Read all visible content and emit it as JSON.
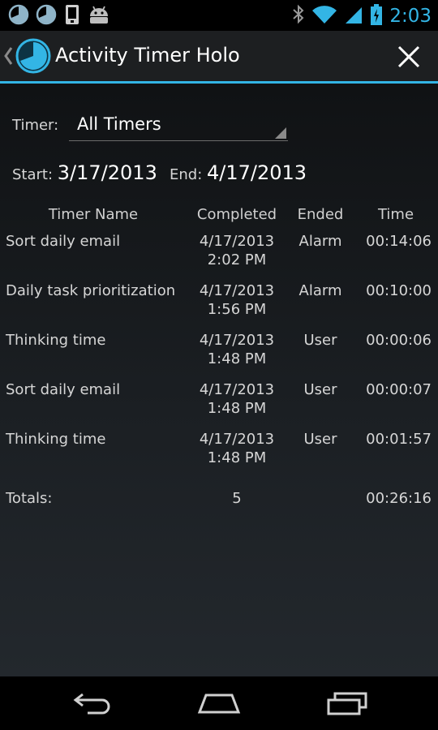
{
  "statusbar": {
    "time": "2:03",
    "left_icons": [
      "activity-timer-icon",
      "activity-timer-icon",
      "phone-icon",
      "android-icon"
    ],
    "right_icons": [
      "bluetooth-icon",
      "wifi-icon",
      "signal-icon",
      "battery-icon"
    ]
  },
  "actionbar": {
    "title": "Activity Timer Holo",
    "close_icon": "close-icon"
  },
  "filter": {
    "timer_label": "Timer:",
    "timer_value": "All Timers",
    "start_label": "Start:",
    "start_value": "3/17/2013",
    "end_label": "End:",
    "end_value": "4/17/2013"
  },
  "table": {
    "headers": [
      "Timer Name",
      "Completed",
      "Ended",
      "Time"
    ],
    "rows": [
      {
        "name": "Sort daily email",
        "date": "4/17/2013",
        "time_of_day": "2:02 PM",
        "ended": "Alarm",
        "duration": "00:14:06"
      },
      {
        "name": "Daily task prioritization",
        "date": "4/17/2013",
        "time_of_day": "1:56 PM",
        "ended": "Alarm",
        "duration": "00:10:00"
      },
      {
        "name": "Thinking time",
        "date": "4/17/2013",
        "time_of_day": "1:48 PM",
        "ended": "User",
        "duration": "00:00:06"
      },
      {
        "name": "Sort daily email",
        "date": "4/17/2013",
        "time_of_day": "1:48 PM",
        "ended": "User",
        "duration": "00:00:07"
      },
      {
        "name": "Thinking time",
        "date": "4/17/2013",
        "time_of_day": "1:48 PM",
        "ended": "User",
        "duration": "00:01:57"
      }
    ],
    "totals": {
      "label": "Totals:",
      "count": "5",
      "duration": "00:26:16"
    }
  },
  "navbar": {
    "icons": [
      "back-icon",
      "home-icon",
      "recent-apps-icon"
    ]
  },
  "colors": {
    "accent": "#33b5e5",
    "background": "#000000",
    "text": "#e8e8e8"
  }
}
